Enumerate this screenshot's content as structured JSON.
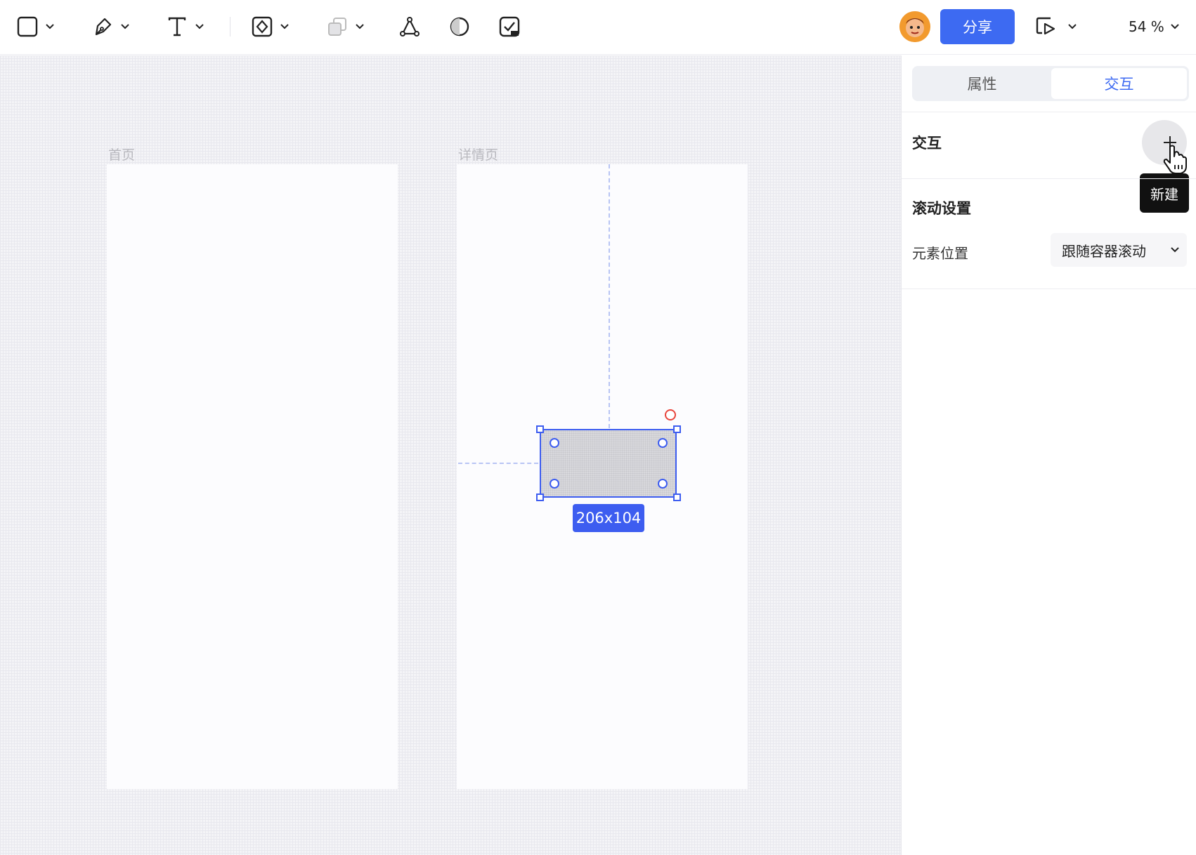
{
  "toolbar": {
    "tools": [
      {
        "name": "rectangle-tool",
        "icon": "square-icon",
        "has_dropdown": true
      },
      {
        "name": "pen-tool",
        "icon": "pen-icon",
        "has_dropdown": true
      },
      {
        "name": "text-tool",
        "icon": "text-icon",
        "has_dropdown": true
      },
      {
        "name": "component-tool",
        "icon": "component-icon",
        "has_dropdown": true
      },
      {
        "name": "boolean-tool",
        "icon": "boolean-icon",
        "has_dropdown": true
      },
      {
        "name": "vector-network-tool",
        "icon": "vector-network-icon",
        "has_dropdown": false
      },
      {
        "name": "contrast-tool",
        "icon": "half-circle-icon",
        "has_dropdown": false
      },
      {
        "name": "ai-check-tool",
        "icon": "ai-check-icon",
        "has_dropdown": false
      }
    ],
    "share_label": "分享",
    "zoom_label": "54 %"
  },
  "canvas": {
    "frames": [
      {
        "label": "首页"
      },
      {
        "label": "详情页"
      }
    ],
    "selection_size": "206x104"
  },
  "panel": {
    "tabs": [
      {
        "label": "属性",
        "active": false
      },
      {
        "label": "交互",
        "active": true
      }
    ],
    "interaction_title": "交互",
    "add_tooltip": "新建",
    "scroll_title": "滚动设置",
    "element_position_label": "元素位置",
    "element_position_value": "跟随容器滚动"
  },
  "colors": {
    "accent": "#3d6af2",
    "selection": "#3d5df0",
    "rotate_handle": "#e8443b",
    "tooltip_bg": "#111111"
  }
}
